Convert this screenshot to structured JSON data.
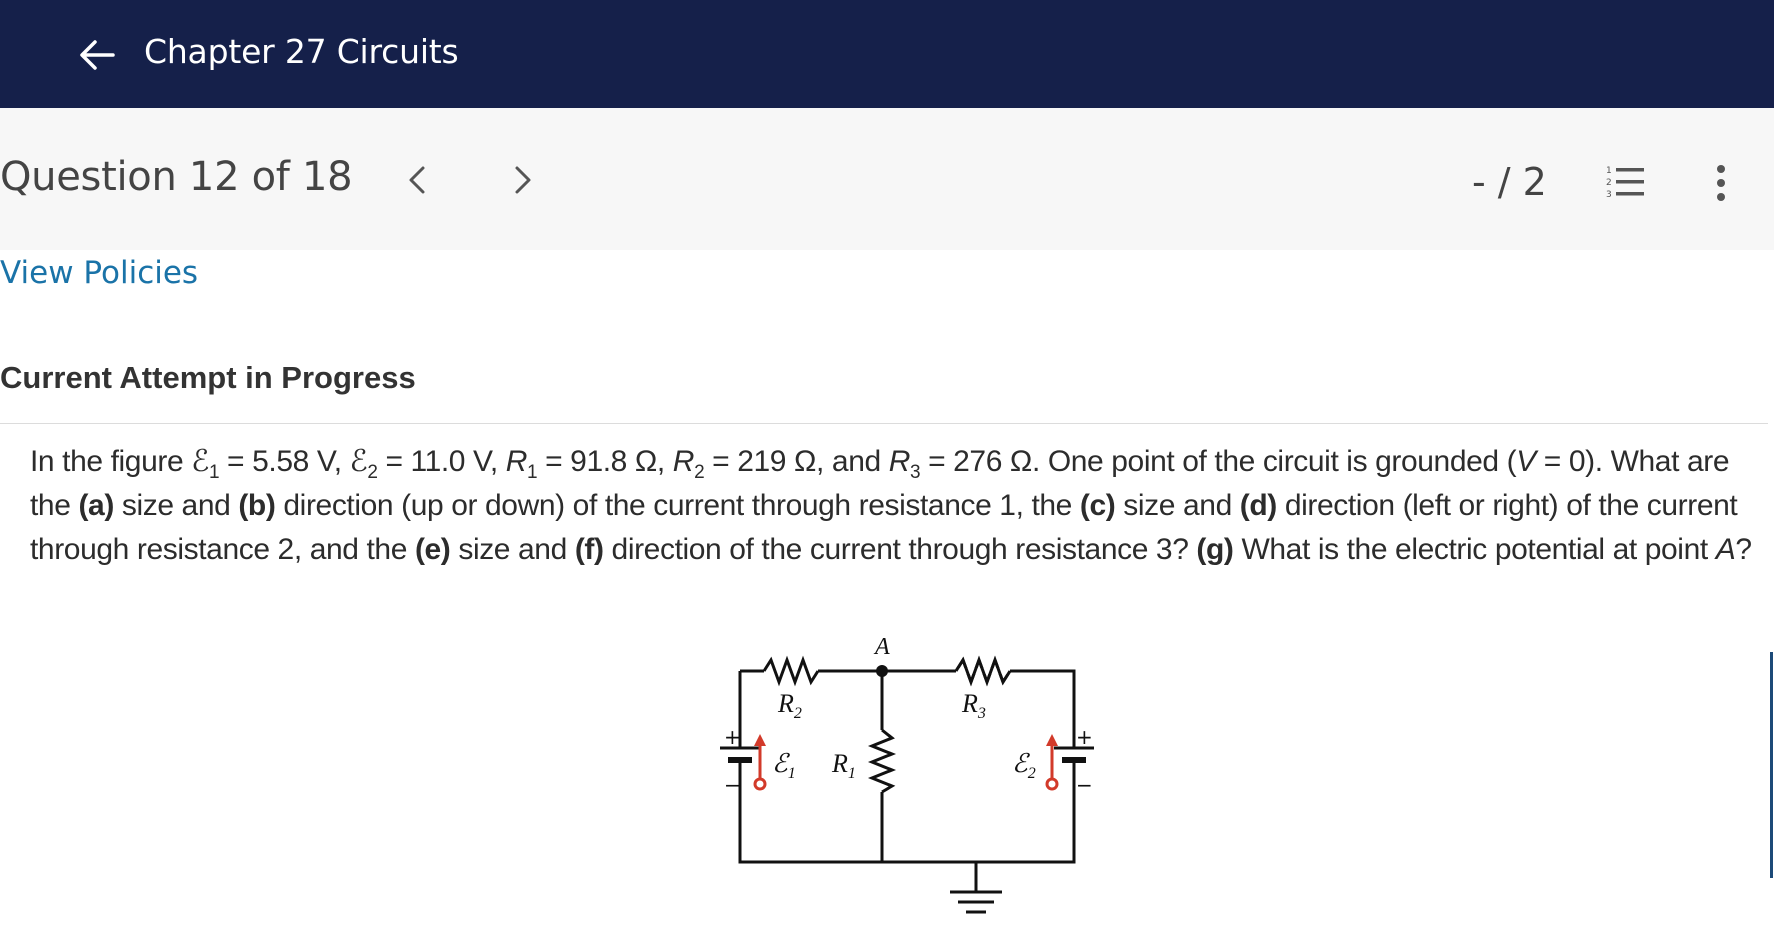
{
  "header": {
    "back_label": "back",
    "title": "Chapter 27 Circuits"
  },
  "question_bar": {
    "counter": "Question 12 of 18",
    "score": "- / 2",
    "icons": [
      "chevron-left-icon",
      "chevron-right-icon",
      "numbered-list-icon",
      "more-vertical-icon"
    ]
  },
  "links": {
    "view_policies": "View Policies"
  },
  "attempt": {
    "heading": "Current Attempt in Progress"
  },
  "question": {
    "s1": "In the figure ",
    "emf1_sym": "ℰ",
    "emf1_sub": "1",
    "s2": " = 5.58 V, ",
    "emf2_sym": "ℰ",
    "emf2_sub": "2",
    "s3": " = 11.0 V, ",
    "r1_sym": "R",
    "r1_sub": "1",
    "s4": " = 91.8 Ω, ",
    "r2_sym": "R",
    "r2_sub": "2",
    "s5": " = 219 Ω, and ",
    "r3_sym": "R",
    "r3_sub": "3",
    "s6": " = 276 Ω. One point of the circuit is grounded (",
    "v_sym": "V",
    "s7": " = 0). What are the ",
    "pa": "(a)",
    "s8": " size and ",
    "pb": "(b)",
    "s9": " direction (up or down) of the current through resistance 1, the ",
    "pc": "(c)",
    "s10": " size and ",
    "pd": "(d)",
    "s11": " direction (left or right) of the current through resistance 2, and the ",
    "pe": "(e)",
    "s12": " size and ",
    "pf": "(f)",
    "s13": " direction of the current through resistance 3? ",
    "pg": "(g)",
    "s14": " What is the electric potential at point ",
    "a_sym": "A",
    "s15": "?"
  },
  "figure": {
    "point_label": "A",
    "r1": "R",
    "r1_sub": "1",
    "r2": "R",
    "r2_sub": "2",
    "r3": "R",
    "r3_sub": "3",
    "e1": "ℰ",
    "e1_sub": "1",
    "e2": "ℰ",
    "e2_sub": "2",
    "plus": "+",
    "minus": "−",
    "colors": {
      "wire": "#111111",
      "emf_arrow": "#d23a2a"
    }
  }
}
